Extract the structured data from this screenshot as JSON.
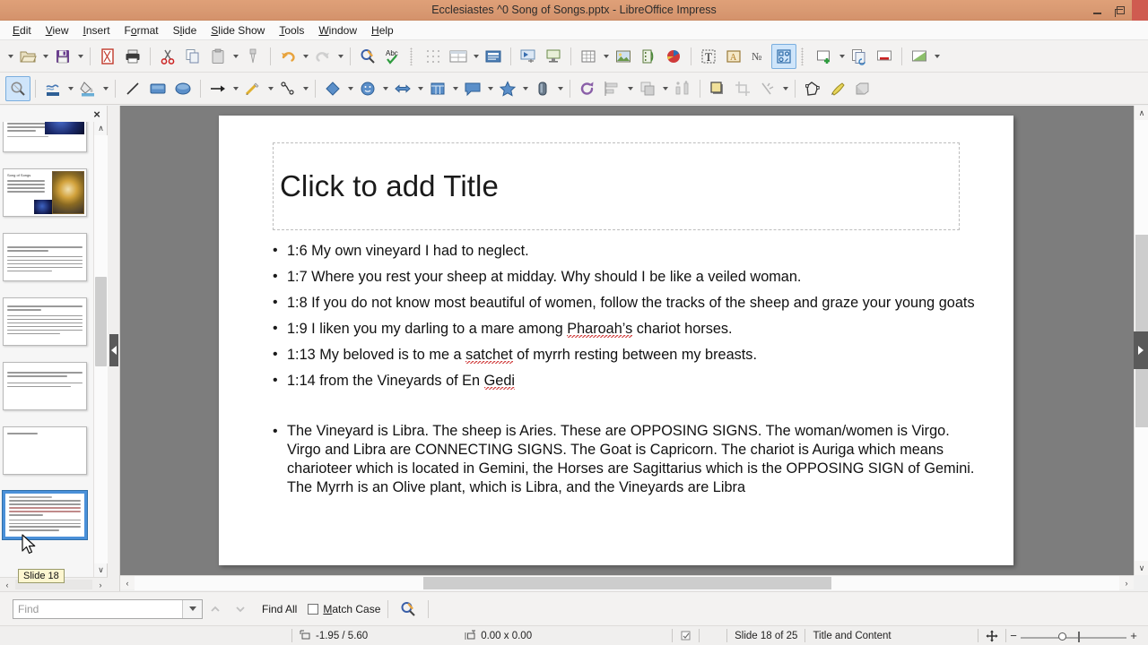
{
  "window": {
    "title": "Ecclesiastes ^0 Song of Songs.pptx - LibreOffice Impress",
    "minimize_label": "Minimize",
    "maximize_label": "Restore",
    "close_label": "Close",
    "titlebar_color": "#d99a73",
    "close_color": "#cf5b50"
  },
  "menubar": {
    "items": [
      {
        "label": "Edit",
        "mnemonic": "E"
      },
      {
        "label": "View",
        "mnemonic": "V"
      },
      {
        "label": "Insert",
        "mnemonic": "I"
      },
      {
        "label": "Format",
        "mnemonic": "o"
      },
      {
        "label": "Slide",
        "mnemonic": "l"
      },
      {
        "label": "Slide Show",
        "mnemonic": "S"
      },
      {
        "label": "Tools",
        "mnemonic": "T"
      },
      {
        "label": "Window",
        "mnemonic": "W"
      },
      {
        "label": "Help",
        "mnemonic": "H"
      }
    ]
  },
  "toolbar_standard": {
    "buttons": [
      {
        "name": "open-icon",
        "tooltip": "Open",
        "dropdown": true,
        "pre_dropdown": true
      },
      {
        "name": "save-icon",
        "tooltip": "Save",
        "dropdown": true
      },
      {
        "name": "export-pdf-icon",
        "tooltip": "Export as PDF"
      },
      {
        "name": "print-icon",
        "tooltip": "Print"
      },
      {
        "name": "cut-icon",
        "tooltip": "Cut"
      },
      {
        "name": "copy-icon",
        "tooltip": "Copy"
      },
      {
        "name": "paste-icon",
        "tooltip": "Paste",
        "dropdown": true
      },
      {
        "name": "clone-formatting-icon",
        "tooltip": "Clone Formatting"
      },
      {
        "name": "undo-icon",
        "tooltip": "Undo",
        "dropdown": true
      },
      {
        "name": "redo-icon",
        "tooltip": "Redo",
        "dropdown": true
      },
      {
        "name": "find-replace-icon",
        "tooltip": "Find and Replace"
      },
      {
        "name": "spelling-icon",
        "tooltip": "Spelling"
      },
      {
        "name": "display-grid-icon",
        "tooltip": "Display Grid"
      },
      {
        "name": "display-views-icon",
        "tooltip": "Display Views",
        "dropdown": true
      },
      {
        "name": "master-slide-icon",
        "tooltip": "Master Slide"
      },
      {
        "name": "start-from-first-slide-icon",
        "tooltip": "Start from First Slide"
      },
      {
        "name": "start-from-current-slide-icon",
        "tooltip": "Start from Current Slide"
      },
      {
        "name": "insert-table-icon",
        "tooltip": "Insert Table",
        "dropdown": true
      },
      {
        "name": "insert-image-icon",
        "tooltip": "Insert Image"
      },
      {
        "name": "insert-audio-video-icon",
        "tooltip": "Insert Audio or Video"
      },
      {
        "name": "insert-chart-icon",
        "tooltip": "Insert Chart"
      },
      {
        "name": "insert-text-box-icon",
        "tooltip": "Insert Text Box"
      },
      {
        "name": "insert-fontwork-icon",
        "tooltip": "Insert Fontwork Text"
      },
      {
        "name": "insert-special-character-icon",
        "tooltip": "Insert Special Character"
      },
      {
        "name": "show-draw-functions-icon",
        "tooltip": "Show Draw Functions",
        "active": true
      },
      {
        "name": "new-slide-icon",
        "tooltip": "New Slide",
        "dropdown": true
      },
      {
        "name": "duplicate-slide-icon",
        "tooltip": "Duplicate Slide"
      },
      {
        "name": "delete-slide-icon",
        "tooltip": "Delete Slide"
      },
      {
        "name": "slide-layout-icon",
        "tooltip": "Slide Layout",
        "dropdown": true
      }
    ]
  },
  "toolbar_drawing": {
    "buttons": [
      {
        "name": "select-icon",
        "tooltip": "Select",
        "active": true
      },
      {
        "name": "line-color-icon",
        "tooltip": "Line Color",
        "dropdown": true
      },
      {
        "name": "fill-color-icon",
        "tooltip": "Fill Color",
        "dropdown": true
      },
      {
        "name": "insert-line-icon",
        "tooltip": "Insert Line"
      },
      {
        "name": "rectangle-icon",
        "tooltip": "Rectangle"
      },
      {
        "name": "ellipse-icon",
        "tooltip": "Ellipse"
      },
      {
        "name": "lines-and-arrows-icon",
        "tooltip": "Lines and Arrows",
        "dropdown": true
      },
      {
        "name": "curves-and-polygons-icon",
        "tooltip": "Curves and Polygons",
        "dropdown": true
      },
      {
        "name": "connectors-icon",
        "tooltip": "Connectors",
        "dropdown": true
      },
      {
        "name": "basic-shapes-icon",
        "tooltip": "Basic Shapes",
        "dropdown": true
      },
      {
        "name": "symbol-shapes-icon",
        "tooltip": "Symbol Shapes",
        "dropdown": true
      },
      {
        "name": "block-arrows-icon",
        "tooltip": "Block Arrows",
        "dropdown": true
      },
      {
        "name": "flowchart-shapes-icon",
        "tooltip": "Flowchart",
        "dropdown": true
      },
      {
        "name": "callout-shapes-icon",
        "tooltip": "Callouts",
        "dropdown": true
      },
      {
        "name": "stars-shapes-icon",
        "tooltip": "Stars and Banners",
        "dropdown": true
      },
      {
        "name": "3d-objects-icon",
        "tooltip": "3D Objects",
        "dropdown": true
      },
      {
        "name": "rotate-icon",
        "tooltip": "Rotate"
      },
      {
        "name": "align-objects-icon",
        "tooltip": "Align Objects",
        "dropdown": true
      },
      {
        "name": "arrange-icon",
        "tooltip": "Arrange",
        "dropdown": true
      },
      {
        "name": "distribute-icon",
        "tooltip": "Distribute Selection"
      },
      {
        "name": "shadow-icon",
        "tooltip": "Shadow"
      },
      {
        "name": "crop-image-icon",
        "tooltip": "Crop Image"
      },
      {
        "name": "filter-icon",
        "tooltip": "Filter",
        "dropdown": true
      },
      {
        "name": "edit-points-icon",
        "tooltip": "Edit Points"
      },
      {
        "name": "show-gluepoint-functions-icon",
        "tooltip": "Show Gluepoint Functions"
      },
      {
        "name": "toggle-extrusion-icon",
        "tooltip": "Toggle Extrusion"
      }
    ]
  },
  "slide_panel": {
    "close_label": "×",
    "scroll_up_label": "∧",
    "scroll_down_label": "∨",
    "prev_label": "‹",
    "next_label": "›",
    "tooltip": "Slide 18",
    "thumbnails": [
      {
        "index": 14,
        "kind": "text-image-blue",
        "selected": false
      },
      {
        "index": 15,
        "kind": "title-bullets-zodiac",
        "selected": false,
        "title": "Song of Songs"
      },
      {
        "index": 16,
        "kind": "text-only",
        "selected": false
      },
      {
        "index": 17,
        "kind": "text-dense",
        "selected": false
      },
      {
        "index": 18,
        "kind": "text-short",
        "selected": false
      },
      {
        "index": 19,
        "kind": "title-only",
        "selected": false,
        "title": "Song of Songs"
      },
      {
        "index": 20,
        "kind": "current-slide",
        "selected": true
      }
    ]
  },
  "slide": {
    "title_placeholder": "Click to add Title",
    "bullets": [
      {
        "bullet": "•",
        "runs": [
          {
            "t": "1:6 My own vineyard I had to neglect."
          }
        ]
      },
      {
        "bullet": "•",
        "runs": [
          {
            "t": "1:7 Where you rest your sheep at midday. Why should I be like a veiled woman."
          }
        ]
      },
      {
        "bullet": "•",
        "runs": [
          {
            "t": "1:8 If you do not know most beautiful of women, follow the tracks of the sheep and graze your young goats"
          }
        ]
      },
      {
        "bullet": "•",
        "runs": [
          {
            "t": "1:9 I liken you my darling to a mare among "
          },
          {
            "t": "Pharoah’s",
            "spell": true
          },
          {
            "t": " chariot horses."
          }
        ]
      },
      {
        "bullet": "•",
        "runs": [
          {
            "t": "1:13 My beloved is to me a "
          },
          {
            "t": "satchet",
            "spell": true
          },
          {
            "t": " of myrrh resting between my breasts."
          }
        ]
      },
      {
        "bullet": "•",
        "runs": [
          {
            "t": "1:14 from the Vineyards of En "
          },
          {
            "t": "Gedi",
            "spell": true
          }
        ]
      }
    ],
    "paragraph": {
      "bullet": "•",
      "text": "The Vineyard is Libra. The sheep is Aries. These are OPPOSING SIGNS. The woman/women is Virgo. Virgo and Libra are CONNECTING SIGNS. The Goat is Capricorn. The chariot is Auriga which means charioteer which is located in Gemini, the Horses are Sagittarius which is the OPPOSING SIGN of Gemini. The Myrrh is an Olive plant, which is Libra, and the Vineyards are Libra"
    }
  },
  "findbar": {
    "placeholder": "Find",
    "value": "",
    "dropdown_label": "▾",
    "find_prev_label": "⌃",
    "find_next_label": "⌄",
    "find_all_label": "Find All",
    "match_case_label": "Match Case",
    "match_case_checked": false,
    "find_replace_icon_label": "Find and Replace"
  },
  "statusbar": {
    "cursor_position": "-1.95 / 5.60",
    "object_size": "0.00 x 0.00",
    "slide_info": "Slide 18 of 25",
    "layout_name": "Title and Content",
    "zoom_minus": "−",
    "zoom_plus": "+",
    "fit_icon_label": "Fit slide to window"
  },
  "scrollbars": {
    "v_up": "∧",
    "v_down": "∨",
    "h_left": "‹",
    "h_right": "›"
  }
}
